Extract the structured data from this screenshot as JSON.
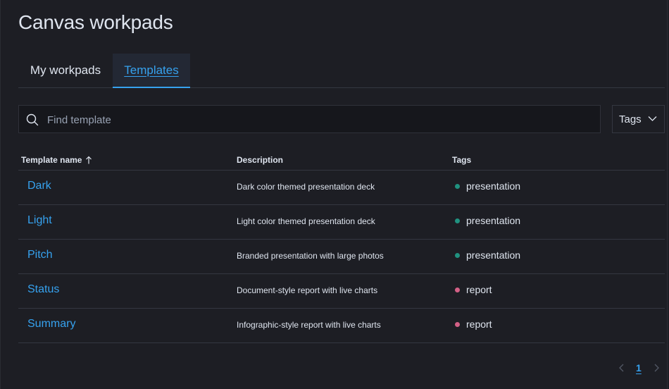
{
  "page": {
    "title": "Canvas workpads"
  },
  "tabs": [
    {
      "label": "My workpads",
      "selected": false
    },
    {
      "label": "Templates",
      "selected": true
    }
  ],
  "search": {
    "placeholder": "Find template",
    "value": "",
    "icon": "search-icon"
  },
  "tags_filter": {
    "label": "Tags",
    "icon": "chevron-down-icon"
  },
  "table": {
    "columns": [
      {
        "label": "Template name",
        "sort": "ascending",
        "sort_icon": "sort-up-arrow-icon"
      },
      {
        "label": "Description"
      },
      {
        "label": "Tags"
      }
    ],
    "rows": [
      {
        "name": "Dark",
        "description": "Dark color themed presentation deck",
        "tag": "presentation",
        "tag_color": "#209280"
      },
      {
        "name": "Light",
        "description": "Light color themed presentation deck",
        "tag": "presentation",
        "tag_color": "#209280"
      },
      {
        "name": "Pitch",
        "description": "Branded presentation with large photos",
        "tag": "presentation",
        "tag_color": "#209280"
      },
      {
        "name": "Status",
        "description": "Document-style report with live charts",
        "tag": "report",
        "tag_color": "#d36086"
      },
      {
        "name": "Summary",
        "description": "Infographic-style report with live charts",
        "tag": "report",
        "tag_color": "#d36086"
      }
    ]
  },
  "pagination": {
    "current_page": "1",
    "prev_enabled": false,
    "next_enabled": false
  },
  "colors": {
    "accent": "#36a2ef",
    "background": "#1d1e24",
    "border": "#343741",
    "text": "#dfe5ef"
  }
}
